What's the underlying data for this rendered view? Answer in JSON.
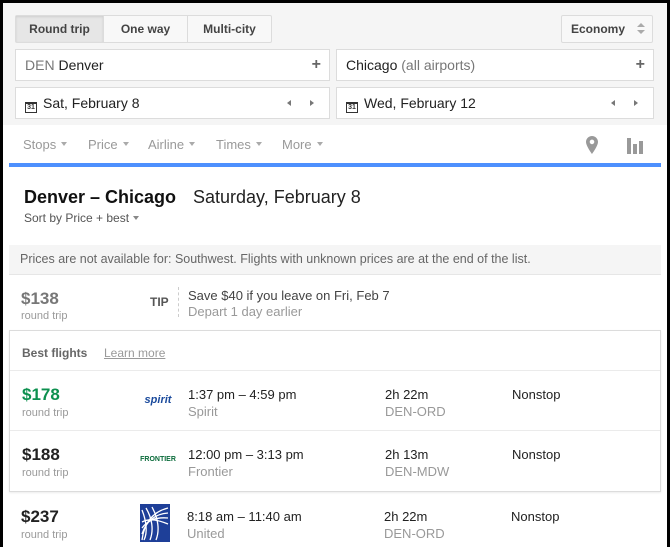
{
  "trip_types": {
    "items": [
      "Round trip",
      "One way",
      "Multi-city"
    ],
    "selected": "Round trip"
  },
  "cabin": {
    "value": "Economy"
  },
  "origin": {
    "code": "DEN",
    "city": "Denver"
  },
  "destination": {
    "city": "Chicago",
    "qualifier": "(all airports)"
  },
  "depart_date": "Sat, February 8",
  "return_date": "Wed, February 12",
  "calendar_glyph": "31",
  "filters": [
    "Stops",
    "Price",
    "Airline",
    "Times",
    "More"
  ],
  "results": {
    "route": "Denver – Chicago",
    "date": "Saturday, February 8",
    "sort_label": "Sort by Price + best"
  },
  "notice": "Prices are not available for: Southwest. Flights with unknown prices are at the end of the list.",
  "tip": {
    "price": "$138",
    "price_sub": "round trip",
    "label": "TIP",
    "line1": "Save $40 if you leave on Fri, Feb 7",
    "line2": "Depart 1 day earlier"
  },
  "best_flights": {
    "title": "Best flights",
    "learn_more": "Learn more"
  },
  "flights": [
    {
      "price": "$178",
      "price_sub": "round trip",
      "logo_text": "spirit",
      "times": "1:37 pm – 4:59 pm",
      "airline": "Spirit",
      "duration": "2h 22m",
      "route": "DEN-ORD",
      "stops": "Nonstop",
      "highlight_color": "#0d904f"
    },
    {
      "price": "$188",
      "price_sub": "round trip",
      "logo_text": "FRONTIER",
      "times": "12:00 pm – 3:13 pm",
      "airline": "Frontier",
      "duration": "2h 13m",
      "route": "DEN-MDW",
      "stops": "Nonstop"
    },
    {
      "price": "$237",
      "price_sub": "round trip",
      "logo_text": "",
      "times": "8:18 am – 11:40 am",
      "airline": "United",
      "duration": "2h 22m",
      "route": "DEN-ORD",
      "stops": "Nonstop"
    }
  ],
  "colors": {
    "accent_blue": "#4d90fe",
    "price_green": "#0d904f",
    "united_blue": "#1e3f98"
  }
}
